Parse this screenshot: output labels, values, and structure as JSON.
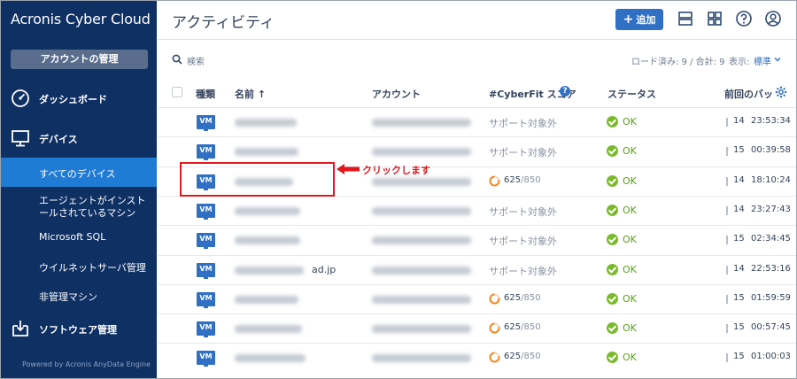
{
  "app": {
    "brand": "Acronis Cyber Cloud",
    "account_button": "アカウントの管理",
    "powered_by": "Powered by Acronis AnyData Engine"
  },
  "sidebar": {
    "main_items": [
      {
        "label": "ダッシュボード",
        "icon": "dashboard-gauge-icon"
      },
      {
        "label": "デバイス",
        "icon": "monitor-icon"
      },
      {
        "label": "ソフトウェア管理",
        "icon": "software-install-icon"
      }
    ],
    "sub_items": [
      {
        "label": "すべてのデバイス",
        "active": true
      },
      {
        "label_line1": "エージェントがインスト",
        "label_line2": "ールされているマシン"
      },
      {
        "label": "Microsoft SQL"
      },
      {
        "label": "ウイルネットサーバ管理"
      },
      {
        "label": "非管理マシン"
      }
    ]
  },
  "header": {
    "title": "アクティビティ",
    "add_button": "追加",
    "icons": [
      "list-view-icon",
      "grid-view-icon",
      "help-icon",
      "user-icon"
    ]
  },
  "toolbar": {
    "search_label": "検索",
    "stats": "ロード済み: 9 / 合計: 9",
    "display_label": "表示:",
    "display_value": "標準"
  },
  "table": {
    "columns": {
      "type": "種類",
      "name": "名前 ↑",
      "account": "アカウント",
      "cyberfit": "#CyberFit スコア",
      "status": "ステータス",
      "last_backup": "前回のバッ"
    },
    "rows": [
      {
        "type": "VM",
        "name_suffix": "",
        "cyberfit": "サポート対象外",
        "status": "OK",
        "day": "14",
        "time": "23:53:34"
      },
      {
        "type": "VM",
        "name_suffix": "",
        "cyberfit": "サポート対象外",
        "status": "OK",
        "day": "15",
        "time": "00:39:58"
      },
      {
        "type": "VM",
        "name_suffix": "",
        "cyberfit_score": "625",
        "cyberfit_max": "/850",
        "status": "OK",
        "day": "14",
        "time": "18:10:24"
      },
      {
        "type": "VM",
        "name_suffix": "",
        "cyberfit": "サポート対象外",
        "status": "OK",
        "day": "14",
        "time": "23:27:43"
      },
      {
        "type": "VM",
        "name_suffix": "",
        "cyberfit": "サポート対象外",
        "status": "OK",
        "day": "15",
        "time": "02:34:45"
      },
      {
        "type": "VM",
        "name_suffix": "ad.jp",
        "cyberfit": "サポート対象外",
        "status": "OK",
        "day": "14",
        "time": "22:53:16"
      },
      {
        "type": "VM",
        "name_suffix": "",
        "cyberfit_score": "625",
        "cyberfit_max": "/850",
        "status": "OK",
        "day": "15",
        "time": "01:59:59"
      },
      {
        "type": "VM",
        "name_suffix": "",
        "cyberfit_score": "625",
        "cyberfit_max": "/850",
        "status": "OK",
        "day": "15",
        "time": "00:57:45"
      },
      {
        "type": "VM",
        "name_suffix": "",
        "cyberfit_score": "625",
        "cyberfit_max": "/850",
        "status": "OK",
        "day": "15",
        "time": "01:00:03"
      }
    ]
  },
  "annotation": {
    "text": "クリックします",
    "color": "#e2181e"
  },
  "colors": {
    "sidebar_bg": "#0f3063",
    "active_item": "#1f7bd3",
    "accent": "#2f6fc4",
    "ok_green": "#7ab92d",
    "score_orange": "#f08a24"
  }
}
